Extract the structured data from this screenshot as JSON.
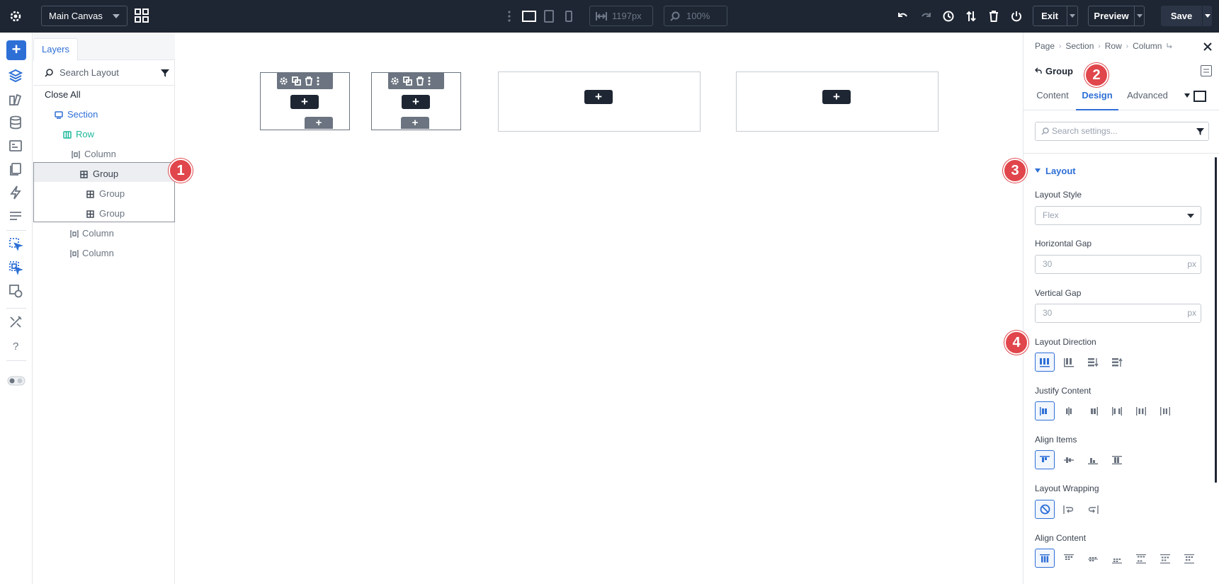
{
  "topbar": {
    "canvas_name": "Main Canvas",
    "width_value": "1197px",
    "zoom_value": "100%",
    "exit_label": "Exit",
    "preview_label": "Preview",
    "save_label": "Save"
  },
  "layers": {
    "tab_label": "Layers",
    "search_placeholder": "Search Layout",
    "close_all_label": "Close All",
    "items": [
      {
        "label": "Section",
        "level": 1,
        "type": "section"
      },
      {
        "label": "Row",
        "level": 2,
        "type": "row"
      },
      {
        "label": "Column",
        "level": 3,
        "type": "column"
      },
      {
        "label": "Group",
        "level": 4,
        "type": "group",
        "selected": true
      },
      {
        "label": "Group",
        "level": 5,
        "type": "group"
      },
      {
        "label": "Group",
        "level": 5,
        "type": "group"
      },
      {
        "label": "Column",
        "level": 3,
        "type": "column"
      },
      {
        "label": "Column",
        "level": 3,
        "type": "column"
      }
    ]
  },
  "settings": {
    "breadcrumbs": [
      "Page",
      "Section",
      "Row",
      "Column"
    ],
    "title": "Group",
    "tabs": [
      {
        "label": "Content",
        "active": false
      },
      {
        "label": "Design",
        "active": true
      },
      {
        "label": "Advanced",
        "active": false
      }
    ],
    "search_placeholder": "Search settings...",
    "section_title": "Layout",
    "layout_style": {
      "label": "Layout Style",
      "value": "Flex"
    },
    "horizontal_gap": {
      "label": "Horizontal Gap",
      "value": "30",
      "unit": "px"
    },
    "vertical_gap": {
      "label": "Vertical Gap",
      "value": "30",
      "unit": "px"
    },
    "layout_direction": {
      "label": "Layout Direction",
      "options": [
        "row",
        "column",
        "row-reverse",
        "column-reverse"
      ],
      "selected": "row"
    },
    "justify_content": {
      "label": "Justify Content",
      "options": [
        "start",
        "center",
        "end",
        "space-between",
        "space-around",
        "space-evenly"
      ],
      "selected": "start"
    },
    "align_items": {
      "label": "Align Items",
      "options": [
        "start",
        "center",
        "end",
        "stretch"
      ],
      "selected": "start"
    },
    "layout_wrapping": {
      "label": "Layout Wrapping",
      "options": [
        "nowrap",
        "wrap",
        "wrap-reverse"
      ],
      "selected": "nowrap"
    },
    "align_content": {
      "label": "Align Content",
      "options": [
        "stretch",
        "start",
        "center",
        "end",
        "space-between",
        "space-around",
        "space-evenly"
      ],
      "selected": "stretch"
    }
  },
  "callouts": [
    "1",
    "2",
    "3",
    "4"
  ],
  "colors": {
    "topbar_bg": "#1e2633",
    "accent_blue": "#2e6fd6",
    "accent_green": "#1bb89a",
    "callout_red": "#e0464b"
  }
}
